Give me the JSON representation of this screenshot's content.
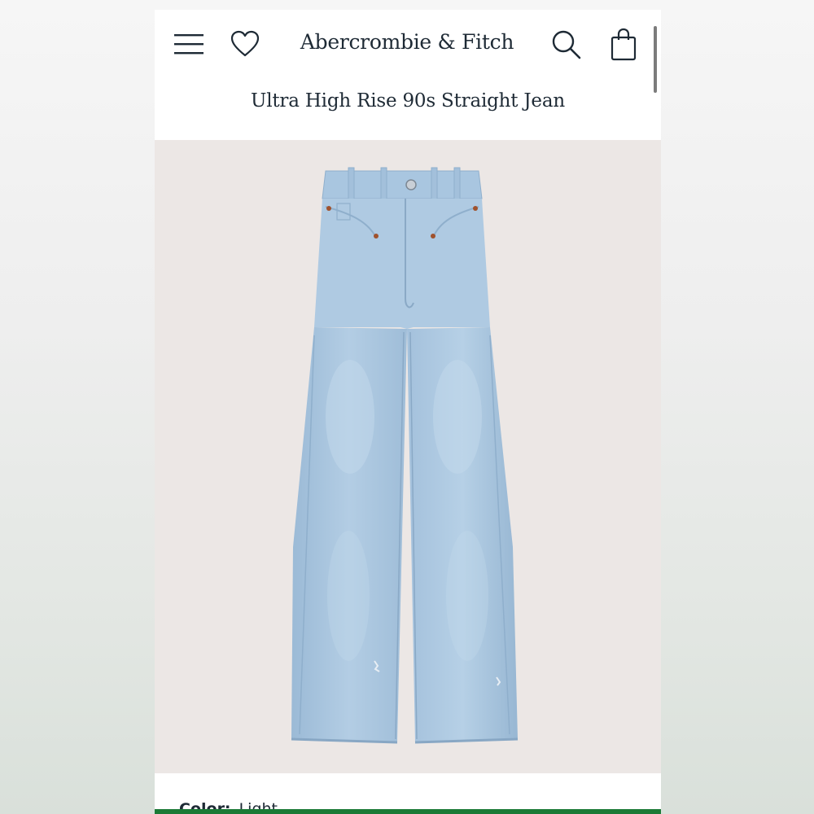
{
  "header": {
    "brand": "Abercrombie & Fitch",
    "icons": [
      "menu-icon",
      "heart-icon",
      "search-icon",
      "shopping-bag-icon"
    ]
  },
  "product": {
    "title": "Ultra High Rise 90s Straight Jean",
    "image": "light-wash-straight-jeans",
    "color_label": "Color:",
    "color_value": "Light"
  },
  "colors": {
    "text": "#1e2a35",
    "image_background": "#ece7e5",
    "denim": "#a9c6e0",
    "accent_bar": "#1b7a36"
  }
}
